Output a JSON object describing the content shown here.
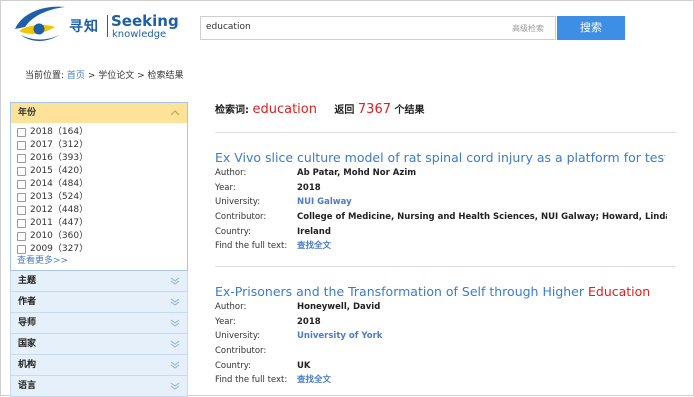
{
  "logo": {
    "cn": "寻知",
    "en": "Seeking",
    "en_sub": "knowledge"
  },
  "search": {
    "query": "education",
    "advanced": "高级检索",
    "button": "搜索"
  },
  "breadcrumb": {
    "prefix": "当前位置:",
    "home": "首页",
    "sep1": ">",
    "section": "学位论文",
    "sep2": ">",
    "current": "检索结果"
  },
  "sidebar": {
    "year_facet": {
      "title": "年份",
      "years": [
        {
          "label": "2018（164）"
        },
        {
          "label": "2017（312）"
        },
        {
          "label": "2016（393）"
        },
        {
          "label": "2015（420）"
        },
        {
          "label": "2014（484）"
        },
        {
          "label": "2013（524）"
        },
        {
          "label": "2012（448）"
        },
        {
          "label": "2011（447）"
        },
        {
          "label": "2010（360）"
        },
        {
          "label": "2009（327）"
        }
      ],
      "more": "查看更多>>"
    },
    "facets": [
      "主题",
      "作者",
      "导师",
      "国家",
      "机构",
      "语言"
    ]
  },
  "summary": {
    "label": "检索词:",
    "term": "education",
    "returns": "返回",
    "count": "7367",
    "suffix": "个结果"
  },
  "labels": {
    "author": "Author:",
    "year": "Year:",
    "university": "University:",
    "contributor": "Contributor:",
    "country": "Country:",
    "fulltext": "Find the full text:"
  },
  "results": [
    {
      "title": "Ex Vivo slice culture model of rat spinal cord injury as a platform for testi...",
      "title_highlight": "",
      "author": "Ab Patar, Mohd Nor Azim",
      "year": "2018",
      "university": "NUI Galway",
      "contributor": "College of Medicine, Nursing and Health Sciences, NUI Galway; Howard, Linda...",
      "country": "Ireland",
      "fulltext": "查找全文"
    },
    {
      "title": "Ex-Prisoners and the Transformation of Self through Higher ",
      "title_highlight": "Education",
      "author": "Honeywell, David",
      "year": "2018",
      "university": "University of York",
      "contributor": "",
      "country": "UK",
      "fulltext": "查找全文"
    }
  ],
  "colors": {
    "accent": "#3d8ee5",
    "highlight": "#e02020",
    "link": "#4a7cc7",
    "facet_open": "#fde39a"
  }
}
